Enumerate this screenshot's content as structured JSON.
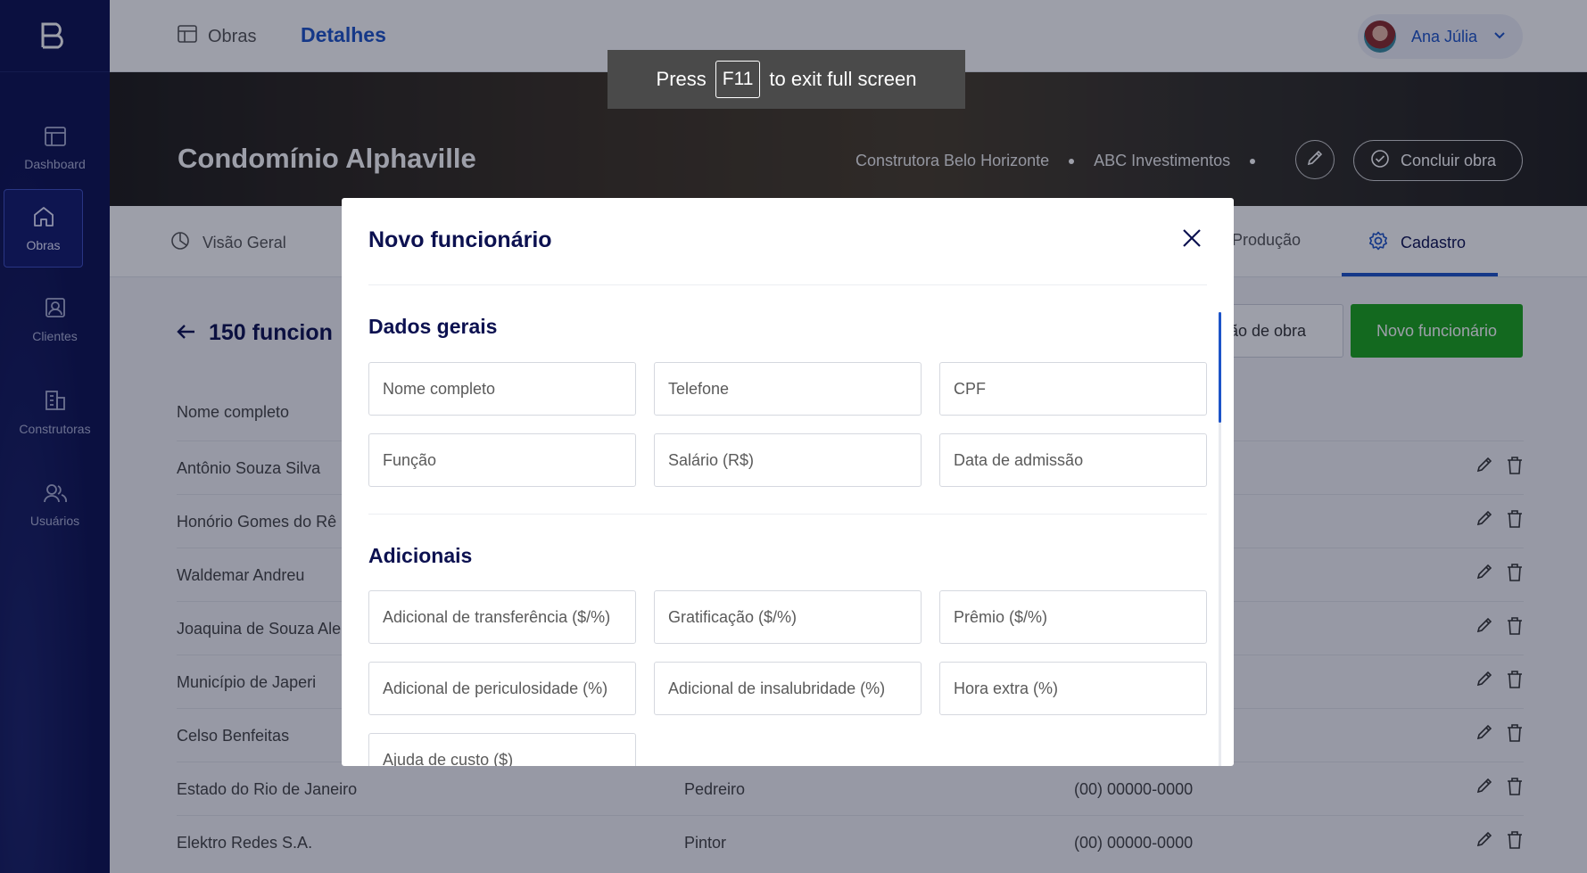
{
  "sidebar": {
    "logo": "logo-icon",
    "items": [
      {
        "label": "Dashboard",
        "icon": "dashboard-icon"
      },
      {
        "label": "Obras",
        "icon": "home-icon"
      },
      {
        "label": "Clientes",
        "icon": "client-icon"
      },
      {
        "label": "Construtoras",
        "icon": "building-icon"
      },
      {
        "label": "Usuários",
        "icon": "users-icon"
      }
    ]
  },
  "header": {
    "breadcrumb_root": "Obras",
    "breadcrumb_current": "Detalhes",
    "user_name": "Ana Júlia"
  },
  "hero": {
    "title": "Condomínio Alphaville",
    "builder": "Construtora Belo Horizonte",
    "client": "ABC Investimentos",
    "conclude_label": "Concluir obra"
  },
  "tabs": {
    "overview": "Visão Geral",
    "production": "Produção",
    "register": "Cadastro"
  },
  "content": {
    "title": "150 funcion",
    "labor_button": "ão de obra",
    "new_button": "Novo funcionário",
    "col_name": "Nome completo",
    "rows": [
      {
        "name": "Antônio Souza Silva",
        "role": "",
        "phone": ""
      },
      {
        "name": "Honório Gomes do Rê",
        "role": "",
        "phone": ""
      },
      {
        "name": "Waldemar Andreu",
        "role": "",
        "phone": ""
      },
      {
        "name": "Joaquina de Souza Ale",
        "role": "",
        "phone": ""
      },
      {
        "name": "Município de Japeri",
        "role": "",
        "phone": ""
      },
      {
        "name": "Celso Benfeitas",
        "role": "",
        "phone": ""
      },
      {
        "name": "Estado do Rio de Janeiro",
        "role": "Pedreiro",
        "phone": "(00) 00000-0000"
      },
      {
        "name": "Elektro Redes S.A.",
        "role": "Pintor",
        "phone": "(00) 00000-0000"
      }
    ]
  },
  "toast": {
    "press": "Press",
    "key": "F11",
    "rest": "to exit full screen"
  },
  "modal": {
    "title": "Novo funcionário",
    "section_general": "Dados gerais",
    "section_additional": "Adicionais",
    "general_fields": [
      "Nome completo",
      "Telefone",
      "CPF",
      "Função",
      "Salário (R$)",
      "Data de admissão"
    ],
    "additional_fields": [
      "Adicional de transferência ($/%)",
      "Gratificação ($/%)",
      "Prêmio ($/%)",
      "Adicional de periculosidade (%)",
      "Adicional de insalubridade (%)",
      "Hora extra (%)",
      "Ajuda de custo ($)"
    ]
  }
}
